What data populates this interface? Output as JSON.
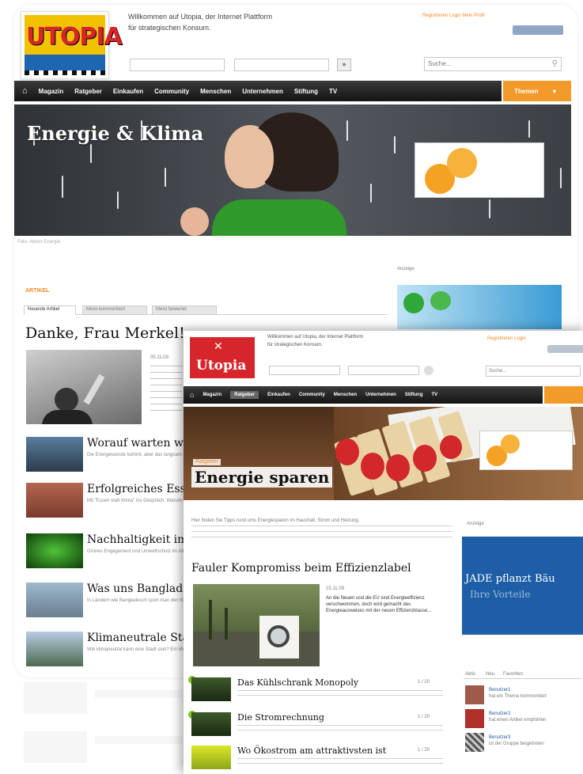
{
  "colors": {
    "accent_orange": "#f29b2a",
    "nav_dark": "#2a2a2a",
    "link_orange": "#f08a24",
    "logo_red": "#d7262b",
    "leaf_green": "#7dc42b"
  },
  "back_page": {
    "logo_text": "UTOPIA",
    "welcome_line1": "Willkommen auf Utopia, der Internet Plattform",
    "welcome_line2": "für strategischen Konsum.",
    "top_links": "Registrieren  Login  Mein Profil",
    "search_placeholder": "Suche...",
    "go_label": "»",
    "nav_items": [
      "Magazin",
      "Ratgeber",
      "Einkaufen",
      "Community",
      "Menschen",
      "Unternehmen",
      "Stiftung",
      "TV"
    ],
    "nav_cta": "Themen",
    "hero_title": "Energie & Klima",
    "hero_caption": "Foto: Aktion Energie",
    "section_label": "ARTIKEL",
    "tabs": [
      "Neueste Artikel",
      "Meist kommentiert",
      "Meist bewertet"
    ],
    "ad_label": "Anzeige",
    "lead_title": "Danke, Frau Merkel!",
    "lead_date": "05.11.09",
    "articles": [
      {
        "title": "Worauf warten wir",
        "text": "Die Energiewende kommt, aber das langsam. Was noch fehlt..."
      },
      {
        "title": "Erfolgreiches Essen",
        "text": "Mit \"Essen statt Klima\" ins Gespräch. Warum Essen wichtig ist..."
      },
      {
        "title": "Nachhaltigkeit im",
        "text": "Grünes Engagement und Umweltschutz im Alltag..."
      },
      {
        "title": "Was uns Banglades",
        "text": "In Ländern wie Bangladesch spürt man den Klimawandel..."
      },
      {
        "title": "Klimaneutrale Stad",
        "text": "Wie klimaneutral kann eine Stadt sein? Ein Modell..."
      }
    ]
  },
  "front_page": {
    "logo_text": "Utopia",
    "welcome_line1": "Willkommen auf Utopia, der Internet Plattform",
    "welcome_line2": "für strategischen Konsum.",
    "top_links": "Registrieren  Login",
    "search_placeholder": "Suche...",
    "nav_items": [
      "Magazin",
      "Ratgeber",
      "Einkaufen",
      "Community",
      "Menschen",
      "Unternehmen",
      "Stiftung",
      "TV"
    ],
    "hero_kicker": "Ratgeber",
    "hero_title": "Energie sparen",
    "intro_text": "Hier finden Sie Tipps rund ums Energiesparen im Haushalt, Strom und Heizung.",
    "ad_label": "Anzeige",
    "lead_title": "Fauler Kompromiss beim Effizienzlabel",
    "lead_date": "15.11.09",
    "lead_body": "An die Neuen und die EU sind Energieeffizienz verschwommen, doch wird gemacht des Energieausweises mit der neuen Effizienzklasse...",
    "ad_banner_text": "JADE pflanzt Bäu",
    "ad_banner_sub": "Ihre Vorteile",
    "list": [
      {
        "title": "Das Kühlschrank Monopoly",
        "meta": "1 / 20"
      },
      {
        "title": "Die Stromrechnung",
        "meta": "1 / 20"
      },
      {
        "title": "Wo Ökostrom am attraktivsten ist",
        "meta": "1 / 20"
      }
    ],
    "sidebar_tabs": [
      "Aktiv",
      "Neu",
      "Favoriten"
    ],
    "people": [
      {
        "name": "Benutzer1",
        "text": "hat ein Thema kommentiert"
      },
      {
        "name": "Benutzer2",
        "text": "hat einen Artikel empfohlen"
      },
      {
        "name": "Benutzer3",
        "text": "ist der Gruppe beigetreten"
      }
    ]
  }
}
